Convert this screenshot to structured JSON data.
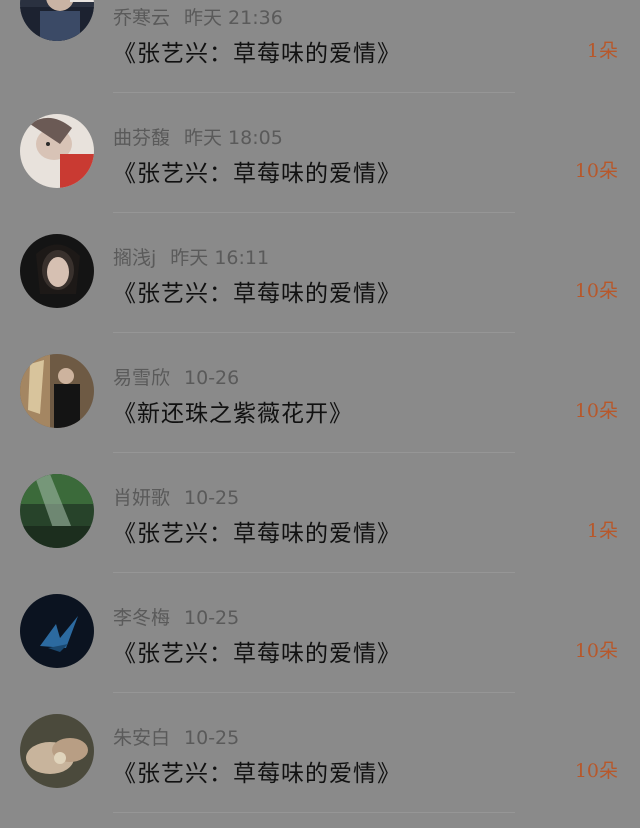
{
  "gifts": [
    {
      "user": "乔寒云",
      "time": "昨天 21:36",
      "drama": "《张艺兴：草莓味的爱情》",
      "amount": "1朵"
    },
    {
      "user": "曲芬馥",
      "time": "昨天 18:05",
      "drama": "《张艺兴：草莓味的爱情》",
      "amount": "10朵"
    },
    {
      "user": "搁浅j",
      "time": "昨天 16:11",
      "drama": "《张艺兴：草莓味的爱情》",
      "amount": "10朵"
    },
    {
      "user": "易雪欣",
      "time": "10-26",
      "drama": "《新还珠之紫薇花开》",
      "amount": "10朵"
    },
    {
      "user": "肖妍歌",
      "time": "10-25",
      "drama": "《张艺兴：草莓味的爱情》",
      "amount": "1朵"
    },
    {
      "user": "李冬梅",
      "time": "10-25",
      "drama": "《张艺兴：草莓味的爱情》",
      "amount": "10朵"
    },
    {
      "user": "朱安白",
      "time": "10-25",
      "drama": "《张艺兴：草莓味的爱情》",
      "amount": "10朵"
    }
  ],
  "colors": {
    "background": "#8a8a8a",
    "amount": "#b7582b",
    "meta": "#5a5a5a",
    "title": "#111111"
  }
}
